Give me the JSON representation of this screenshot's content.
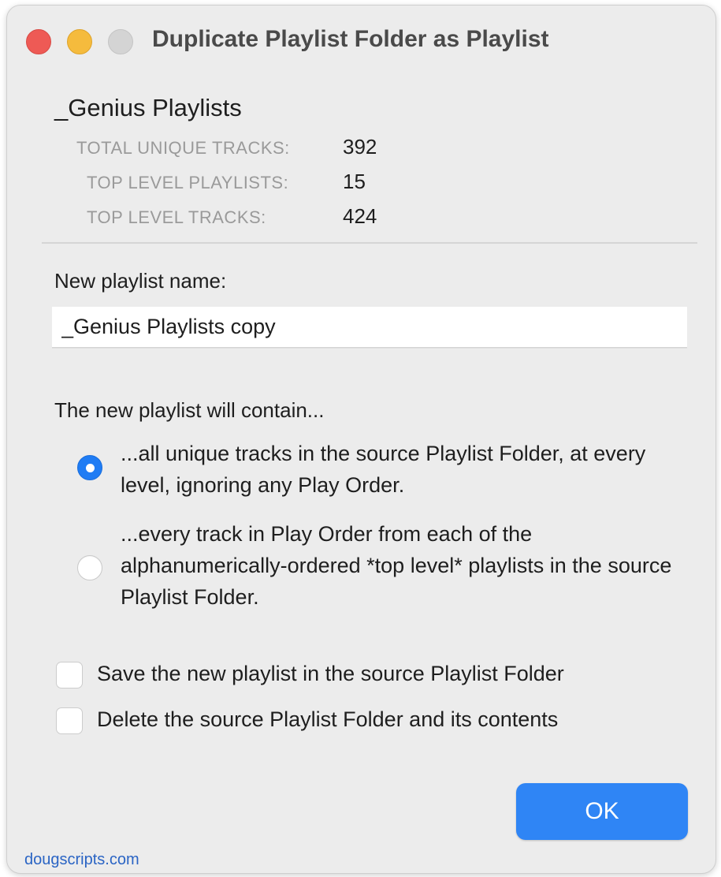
{
  "window": {
    "title": "Duplicate Playlist Folder as Playlist"
  },
  "source": {
    "folder_name": "_Genius Playlists",
    "stats": [
      {
        "label": "TOTAL UNIQUE TRACKS:",
        "value": "392"
      },
      {
        "label": "TOP LEVEL PLAYLISTS:",
        "value": "15"
      },
      {
        "label": "TOP LEVEL TRACKS:",
        "value": "424"
      }
    ]
  },
  "new_playlist": {
    "label": "New playlist name:",
    "value": "_Genius Playlists copy"
  },
  "contain": {
    "heading": "The new playlist will contain...",
    "options": [
      {
        "text": "...all unique tracks in the source Playlist Folder, at every level, ignoring any Play Order.",
        "selected": true
      },
      {
        "text": "...every track in Play Order from each of the alphanumerically-ordered *top level* playlists in the source Playlist Folder.",
        "selected": false
      }
    ]
  },
  "checkboxes": [
    {
      "label": "Save the new playlist in the source Playlist Folder",
      "checked": false
    },
    {
      "label": "Delete the source Playlist Folder and its contents",
      "checked": false
    }
  ],
  "buttons": {
    "ok_label": "OK"
  },
  "footer": {
    "link_text": "dougscripts.com"
  },
  "colors": {
    "accent": "#2f85f5",
    "close": "#ee5a55",
    "minimize": "#f5bb3d",
    "zoom_disabled": "#d4d4d4",
    "link": "#2a64c4"
  },
  "icons": {
    "close": "close-button",
    "minimize": "minimize-button",
    "zoom": "zoom-button"
  }
}
